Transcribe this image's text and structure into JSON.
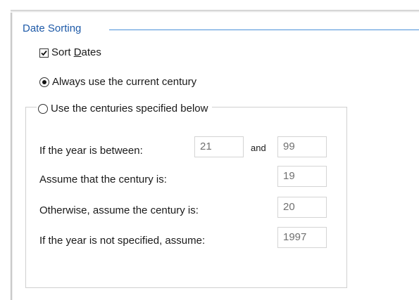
{
  "group": {
    "title": "Date Sorting"
  },
  "sort_dates": {
    "label_pre": "Sort ",
    "label_underlined": "D",
    "label_post": "ates",
    "checked": true
  },
  "options": {
    "always_current": {
      "label": "Always use the current century",
      "selected": true
    },
    "use_specified": {
      "label": "Use the centuries specified below",
      "selected": false
    }
  },
  "century_settings": {
    "year_between_label": "If the year is between:",
    "year_from": "21",
    "and_label": "and",
    "year_to": "99",
    "assume_century_label": "Assume that the century is:",
    "assume_century_value": "19",
    "otherwise_label": "Otherwise, assume the century is:",
    "otherwise_value": "20",
    "unspecified_label": "If the year is not specified, assume:",
    "unspecified_value": "1997"
  },
  "colors": {
    "group_title": "#1e5aa8",
    "group_line": "#4a90d9",
    "disabled_text": "#707070",
    "field_border": "#d4d4d4"
  }
}
